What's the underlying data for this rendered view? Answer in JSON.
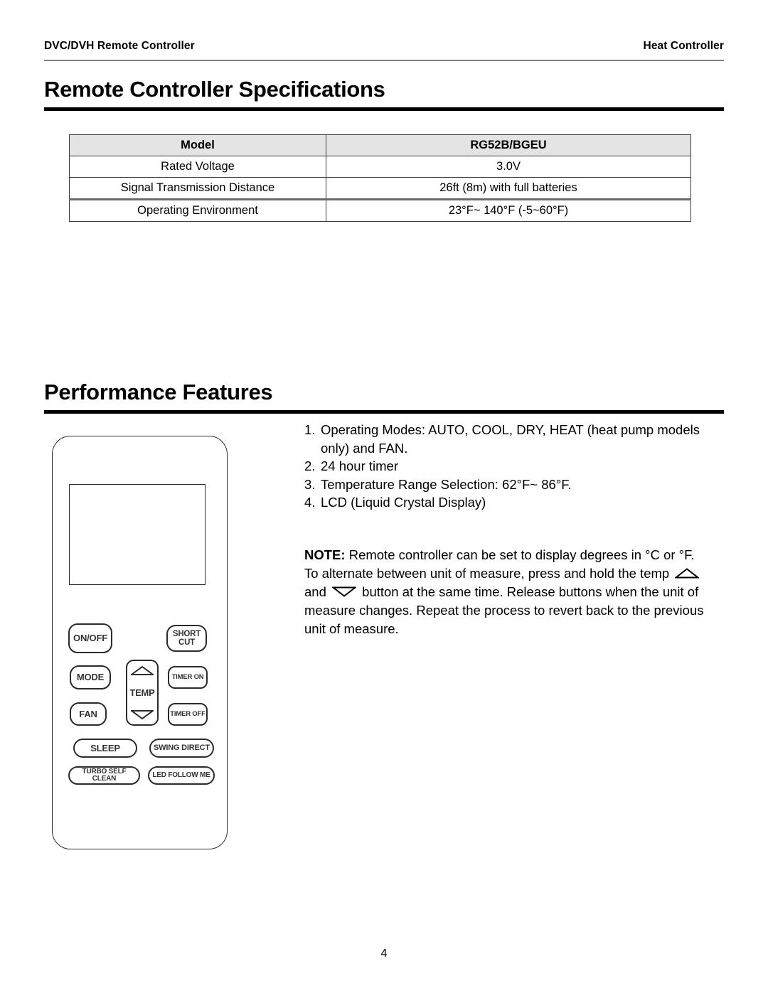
{
  "header": {
    "left": "DVC/DVH Remote Controller",
    "right": "Heat Controller"
  },
  "sections": {
    "specifications_title": "Remote Controller Specifications",
    "performance_title": "Performance Features"
  },
  "spec_table": {
    "header": [
      "Model",
      "RG52B/BGEU"
    ],
    "rows": [
      [
        "Rated Voltage",
        "3.0V"
      ],
      [
        "Signal Transmission Distance",
        "26ft (8m) with full batteries"
      ],
      [
        "Operating Environment",
        "23°F~ 140°F  (-5~60°F)"
      ]
    ]
  },
  "features": [
    {
      "num": "1.",
      "text": "Operating Modes: AUTO, COOL, DRY, HEAT (heat pump models only) and FAN."
    },
    {
      "num": "2.",
      "text": "24 hour timer"
    },
    {
      "num": "3.",
      "text": "Temperature Range Selection: 62°F~ 86°F."
    },
    {
      "num": "4.",
      "text": "LCD (Liquid Crystal Display)"
    }
  ],
  "note": {
    "label": "NOTE:",
    "part1": " Remote controller can be set to display degrees in °C or °F. To alternate between unit of measure, press and hold the temp ",
    "and_word": " and ",
    "part2": " button at the same time. Release buttons when the unit of measure changes. Repeat the process to revert back to the previous unit of measure."
  },
  "remote": {
    "buttons": {
      "onoff": "ON/OFF",
      "shortcut": "SHORT CUT",
      "mode": "MODE",
      "fan": "FAN",
      "timer_on": "TIMER ON",
      "timer_off": "TIMER OFF",
      "temp": "TEMP",
      "sleep": "SLEEP",
      "swing": "SWING DIRECT",
      "turbo": "TURBO SELF CLEAN",
      "led": "LED FOLLOW ME"
    }
  },
  "page_number": "4"
}
